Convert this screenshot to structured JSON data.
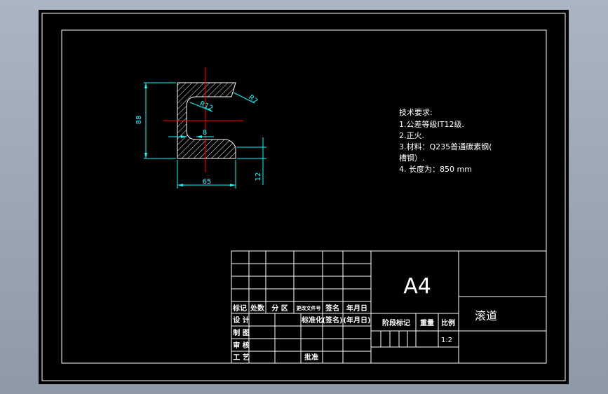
{
  "drawing": {
    "dimensions": {
      "height": "88",
      "flange_width": "65",
      "web_thickness": "8",
      "flange_thickness": "12",
      "inner_radius": "R12",
      "outer_radius": "R7"
    }
  },
  "notes": {
    "heading": "技术要求:",
    "lines": [
      "1.公差等级IT12级.",
      "2.正火.",
      "3.材料：Q235普通碳素钢(",
      "槽钢）.",
      "4. 长度为：850 mm"
    ]
  },
  "title_block": {
    "paper_size": "A4",
    "part_name": "滚道",
    "scale": "1:2",
    "revision_row": [
      "标记",
      "处数",
      "分  区",
      "更改文件号",
      "签名",
      "年月日"
    ],
    "left_labels": [
      "设  计",
      "制  图",
      "审  核",
      "工  艺"
    ],
    "std_label": "标准化",
    "sign_label": "(签名)",
    "date_label": "(年月日)",
    "approve_label": "批准",
    "stage_label": "阶段标记",
    "weight_label": "重量",
    "scale_label": "比例"
  },
  "colors": {
    "background": "#000000",
    "frame": "#ffffff",
    "dimension": "#00ffff",
    "centerline": "#ff0000",
    "hatch": "#ffffff"
  }
}
